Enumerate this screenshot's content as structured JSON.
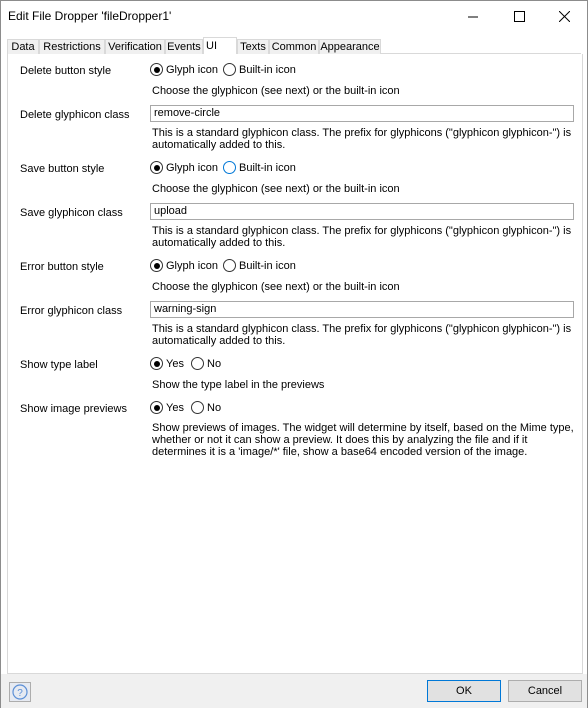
{
  "window": {
    "title": "Edit File Dropper 'fileDropper1'",
    "minimize_icon": "minimize-icon",
    "maximize_icon": "maximize-icon",
    "close_icon": "close-icon"
  },
  "tabs": [
    {
      "label": "Data"
    },
    {
      "label": "Restrictions"
    },
    {
      "label": "Verification"
    },
    {
      "label": "Events"
    },
    {
      "label": "UI",
      "active": true
    },
    {
      "label": "Texts"
    },
    {
      "label": "Common"
    },
    {
      "label": "Appearance"
    }
  ],
  "options": {
    "glyph": "Glyph icon",
    "builtin": "Built-in icon",
    "yes": "Yes",
    "no": "No"
  },
  "rows": {
    "delete_style": {
      "label": "Delete button style",
      "selected": "Glyph icon",
      "desc": "Choose the glyphicon (see next) or the built-in icon"
    },
    "delete_class": {
      "label": "Delete glyphicon class",
      "value": "remove-circle",
      "desc1": "This is a standard glyphicon class. The prefix for glyphicons (\"glyphicon glyphicon-\") is",
      "desc2": "automatically added to this."
    },
    "save_style": {
      "label": "Save button style",
      "selected": "Glyph icon",
      "desc": "Choose the glyphicon (see next) or the built-in icon"
    },
    "save_class": {
      "label": "Save glyphicon class",
      "value": "upload",
      "desc1": "This is a standard glyphicon class. The prefix for glyphicons (\"glyphicon glyphicon-\") is",
      "desc2": "automatically added to this."
    },
    "error_style": {
      "label": "Error button style",
      "selected": "Glyph icon",
      "desc": "Choose the glyphicon (see next) or the built-in icon"
    },
    "error_class": {
      "label": "Error glyphicon class",
      "value": "warning-sign",
      "desc1": "This is a standard glyphicon class. The prefix for glyphicons (\"glyphicon glyphicon-\") is",
      "desc2": "automatically added to this."
    },
    "show_type": {
      "label": "Show type label",
      "selected": "Yes",
      "desc": "Show the type label in the previews"
    },
    "show_previews": {
      "label": "Show image previews",
      "selected": "Yes",
      "desc1": "Show previews of images. The widget will determine by itself, based on the Mime type,",
      "desc2": "whether or not it can show a preview. It does this by analyzing the file and if it",
      "desc3": "determines it is a 'image/*' file, show a base64 encoded version of the image."
    }
  },
  "footer": {
    "help_icon": "help-icon",
    "ok_label": "OK",
    "cancel_label": "Cancel"
  }
}
